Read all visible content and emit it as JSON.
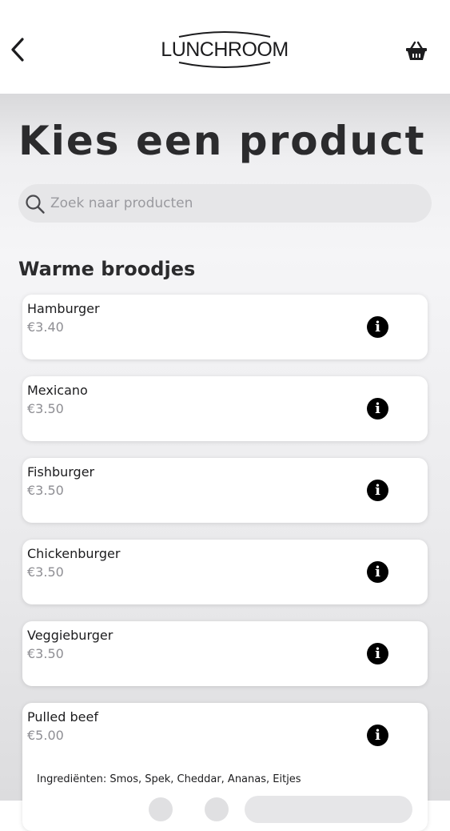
{
  "header": {
    "logo_text": "LUNCHROOM",
    "back_icon": "chevron-left-icon",
    "basket_icon": "basket-icon"
  },
  "page": {
    "title": "Kies een product"
  },
  "search": {
    "placeholder": "Zoek naar producten",
    "value": ""
  },
  "section": {
    "title": "Warme broodjes"
  },
  "products": [
    {
      "name": "Hamburger",
      "price": "€3.40"
    },
    {
      "name": "Mexicano",
      "price": "€3.50"
    },
    {
      "name": "Fishburger",
      "price": "€3.50"
    },
    {
      "name": "Chickenburger",
      "price": "€3.50"
    },
    {
      "name": "Veggieburger",
      "price": "€3.50"
    },
    {
      "name": "Pulled beef",
      "price": "€5.00",
      "ingredients": "Ingrediënten: Smos, Spek, Cheddar, Ananas, Eitjes"
    }
  ],
  "colors": {
    "text_primary": "#1c1c1e",
    "text_secondary": "#8e8e93",
    "title": "#2b2b2d",
    "search_bg": "#e6e6e8"
  }
}
